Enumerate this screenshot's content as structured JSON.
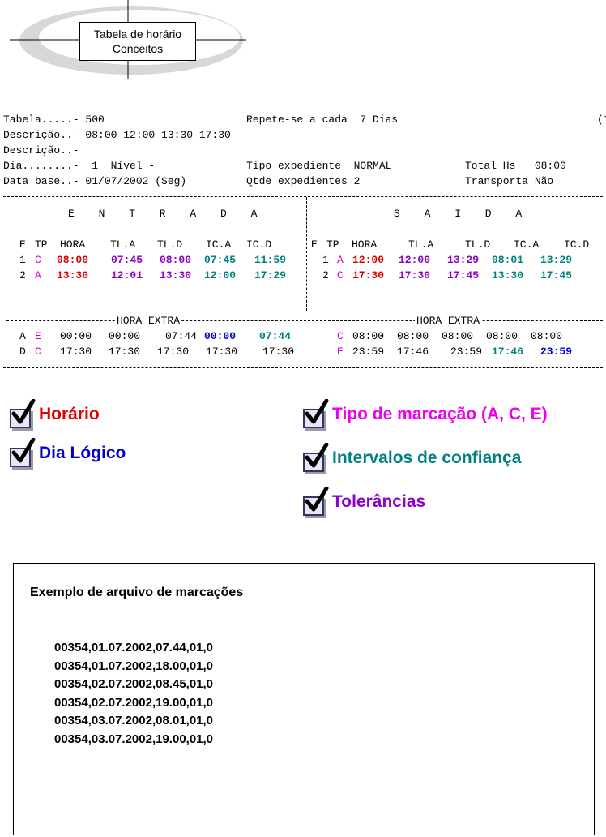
{
  "logo": {
    "line1": "Tabela de horário",
    "line2": "Conceitos"
  },
  "header": {
    "tabela": "Tabela.....- 500",
    "repete": "Repete-se a cada  7 Dias",
    "edge": "(*",
    "descricao1": "Descrição..- 08:00 12:00 13:30 17:30",
    "descricao2": "Descrição..-",
    "dia": "Dia........-  1  Nível -",
    "tipo": "Tipo expediente  NORMAL",
    "total": "Total Hs   08:00",
    "database": "Data base..- 01/07/2002 (Seg)",
    "qtde": "Qtde expedientes 2",
    "transporta": "Transporta Não"
  },
  "table": {
    "entrada_title": "E N T R A D A",
    "saida_title": "S A I D A",
    "columns": [
      "E",
      "TP",
      "HORA",
      "TL.A",
      "TL.D",
      "IC.A",
      "IC.D"
    ],
    "entrada_rows": [
      {
        "e": "1",
        "tp": "C",
        "hora": "08:00",
        "tla": "07:45",
        "tld": "08:00",
        "ica": "07:45",
        "icd": "11:59"
      },
      {
        "e": "2",
        "tp": "A",
        "hora": "13:30",
        "tla": "12:01",
        "tld": "13:30",
        "ica": "12:00",
        "icd": "17:29"
      }
    ],
    "saida_rows": [
      {
        "e": "1",
        "tp": "A",
        "hora": "12:00",
        "tla": "12:00",
        "tld": "13:29",
        "ica": "08:01",
        "icd": "13:29"
      },
      {
        "e": "2",
        "tp": "C",
        "hora": "17:30",
        "tla": "17:30",
        "tld": "17:45",
        "ica": "13:30",
        "icd": "17:45"
      }
    ],
    "hora_extra_label": "HORA EXTRA",
    "extra_left": [
      {
        "e": "A",
        "tp": "E",
        "v1": "00:00",
        "v2": "00:00",
        "v3": "07:44",
        "v4": "00:00",
        "v5": "07:44"
      },
      {
        "e": "D",
        "tp": "C",
        "v1": "17:30",
        "v2": "17:30",
        "v3": "17:30",
        "v4": "17:30",
        "v5": "17:30"
      }
    ],
    "extra_right": [
      {
        "tp": "C",
        "v1": "08:00",
        "v2": "08:00",
        "v3": "08:00",
        "v4": "08:00",
        "v5": "08:00"
      },
      {
        "tp": "E",
        "v1": "23:59",
        "v2": "17:46",
        "v3": "23:59",
        "v4": "17:46",
        "v5": "23:59"
      }
    ]
  },
  "legend": {
    "horario": "Horário",
    "dia_logico": "Dia Lógico",
    "tipo_marcacao": "Tipo de marcação (A, C, E)",
    "intervalos": "Intervalos de confiança",
    "tolerancias": "Tolerâncias"
  },
  "colors": {
    "horario": "#e00000",
    "dia_logico": "#0000cc",
    "tipo_marcacao": "#ee00ee",
    "intervalos": "#008080",
    "tolerancias": "#8b00cc"
  },
  "example": {
    "title": "Exemplo de arquivo de marcações",
    "lines": [
      "00354,01.07.2002,07.44,01,0",
      "00354,01.07.2002,18.00,01,0",
      "00354,02.07.2002,08.45,01,0",
      "00354,02.07.2002,19.00,01,0",
      "00354,03.07.2002,08.01,01,0",
      "00354,03.07.2002,19.00,01,0"
    ]
  }
}
